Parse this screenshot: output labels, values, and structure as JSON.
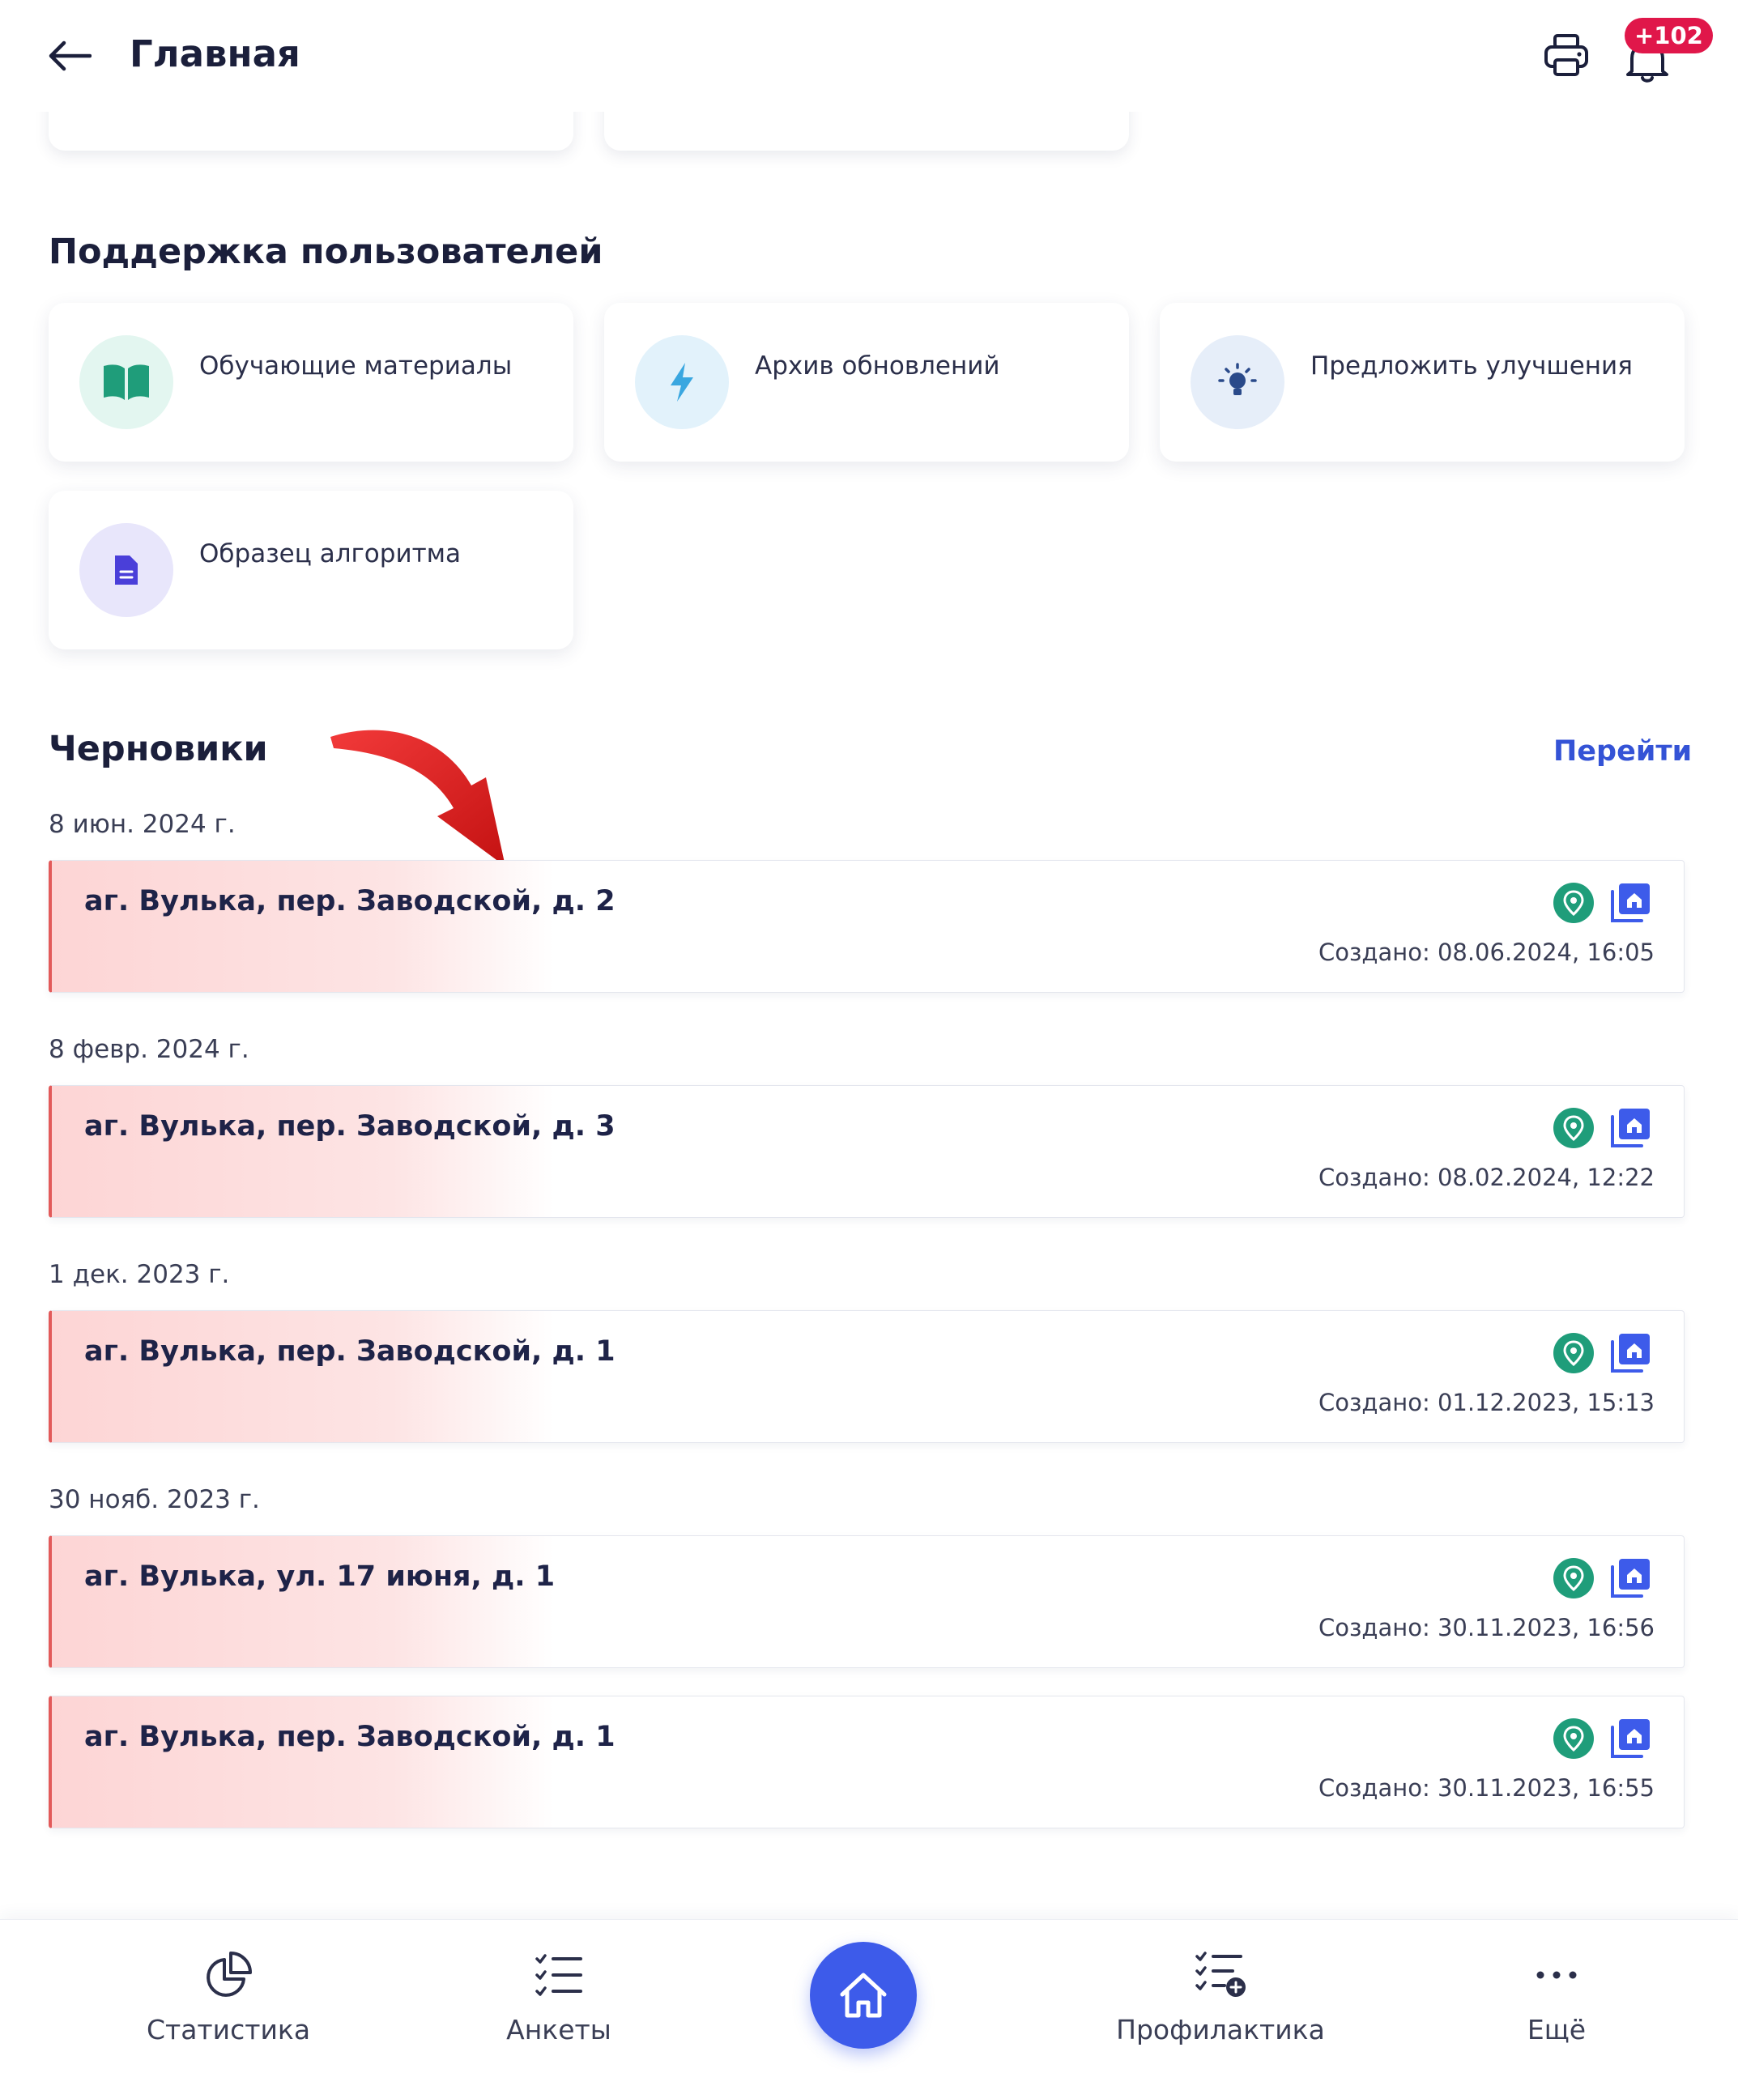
{
  "header": {
    "title": "Главная",
    "notification_count": "+102"
  },
  "support": {
    "title": "Поддержка пользователей",
    "items": [
      {
        "label": "Обучающие материалы",
        "icon": "book-icon",
        "color": "#1f9d7a"
      },
      {
        "label": "Архив обновлений",
        "icon": "lightning-icon",
        "color": "#3aa7e0"
      },
      {
        "label": "Предложить улучшения",
        "icon": "lightbulb-icon",
        "color": "#2a4a8a"
      },
      {
        "label": "Образец алгоритма",
        "icon": "document-icon",
        "color": "#4a3fd9"
      }
    ]
  },
  "drafts": {
    "title": "Черновики",
    "go_label": "Перейти",
    "groups": [
      {
        "date": "8 июн. 2024 г.",
        "items": [
          {
            "address": "аг. Вулька, пер. Заводской, д. 2",
            "created": "Создано: 08.06.2024, 16:05"
          }
        ]
      },
      {
        "date": "8 февр. 2024 г.",
        "items": [
          {
            "address": "аг. Вулька, пер. Заводской, д. 3",
            "created": "Создано: 08.02.2024, 12:22"
          }
        ]
      },
      {
        "date": "1 дек. 2023 г.",
        "items": [
          {
            "address": "аг. Вулька, пер. Заводской, д. 1",
            "created": "Создано: 01.12.2023, 15:13"
          }
        ]
      },
      {
        "date": "30 нояб. 2023 г.",
        "items": [
          {
            "address": "аг. Вулька, ул. 17 июня, д. 1",
            "created": "Создано: 30.11.2023, 16:56"
          },
          {
            "address": "аг. Вулька, пер. Заводской, д. 1",
            "created": "Создано: 30.11.2023, 16:55"
          }
        ]
      }
    ]
  },
  "nav": {
    "items": [
      {
        "label": "Статистика",
        "icon": "pie-chart-icon"
      },
      {
        "label": "Анкеты",
        "icon": "checklist-icon"
      },
      {
        "label": "",
        "icon": "home-icon"
      },
      {
        "label": "Профилактика",
        "icon": "checklist-add-icon"
      },
      {
        "label": "Ещё",
        "icon": "more-icon"
      }
    ]
  },
  "colors": {
    "accent": "#3d5bea",
    "link": "#3453d6",
    "badge": "#e0174a",
    "draft_stripe": "#e25a5a",
    "pin": "#1f9d7a"
  }
}
